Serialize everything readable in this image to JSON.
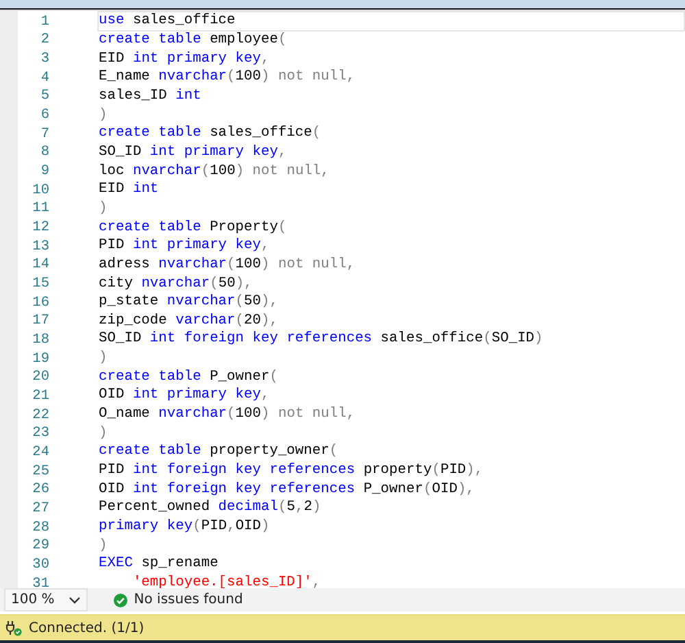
{
  "editor": {
    "lines": [
      {
        "number": "1",
        "current": true,
        "tokens": [
          {
            "kind": "keyword",
            "text": "use"
          },
          {
            "kind": "plain",
            "text": " sales_office"
          }
        ]
      },
      {
        "number": "2",
        "current": false,
        "tokens": [
          {
            "kind": "keyword",
            "text": "create table"
          },
          {
            "kind": "plain",
            "text": " employee"
          },
          {
            "kind": "punct",
            "text": "("
          }
        ]
      },
      {
        "number": "3",
        "current": false,
        "tokens": [
          {
            "kind": "plain",
            "text": "EID "
          },
          {
            "kind": "keyword",
            "text": "int primary key"
          },
          {
            "kind": "punct",
            "text": ","
          }
        ]
      },
      {
        "number": "4",
        "current": false,
        "tokens": [
          {
            "kind": "plain",
            "text": "E_name "
          },
          {
            "kind": "keyword",
            "text": "nvarchar"
          },
          {
            "kind": "punct",
            "text": "("
          },
          {
            "kind": "plain",
            "text": "100"
          },
          {
            "kind": "punct",
            "text": ") not null,"
          }
        ]
      },
      {
        "number": "5",
        "current": false,
        "tokens": [
          {
            "kind": "plain",
            "text": "sales_ID "
          },
          {
            "kind": "keyword",
            "text": "int"
          }
        ]
      },
      {
        "number": "6",
        "current": false,
        "tokens": [
          {
            "kind": "punct",
            "text": ")"
          }
        ]
      },
      {
        "number": "7",
        "current": false,
        "tokens": [
          {
            "kind": "keyword",
            "text": "create table"
          },
          {
            "kind": "plain",
            "text": " sales_office"
          },
          {
            "kind": "punct",
            "text": "("
          }
        ]
      },
      {
        "number": "8",
        "current": false,
        "tokens": [
          {
            "kind": "plain",
            "text": "SO_ID "
          },
          {
            "kind": "keyword",
            "text": "int primary key"
          },
          {
            "kind": "punct",
            "text": ","
          }
        ]
      },
      {
        "number": "9",
        "current": false,
        "tokens": [
          {
            "kind": "plain",
            "text": "loc "
          },
          {
            "kind": "keyword",
            "text": "nvarchar"
          },
          {
            "kind": "punct",
            "text": "("
          },
          {
            "kind": "plain",
            "text": "100"
          },
          {
            "kind": "punct",
            "text": ") not null,"
          }
        ]
      },
      {
        "number": "10",
        "current": false,
        "tokens": [
          {
            "kind": "plain",
            "text": "EID "
          },
          {
            "kind": "keyword",
            "text": "int"
          }
        ]
      },
      {
        "number": "11",
        "current": false,
        "tokens": [
          {
            "kind": "punct",
            "text": ")"
          }
        ]
      },
      {
        "number": "12",
        "current": false,
        "tokens": [
          {
            "kind": "keyword",
            "text": "create table"
          },
          {
            "kind": "plain",
            "text": " Property"
          },
          {
            "kind": "punct",
            "text": "("
          }
        ]
      },
      {
        "number": "13",
        "current": false,
        "tokens": [
          {
            "kind": "plain",
            "text": "PID "
          },
          {
            "kind": "keyword",
            "text": "int primary key"
          },
          {
            "kind": "punct",
            "text": ","
          }
        ]
      },
      {
        "number": "14",
        "current": false,
        "tokens": [
          {
            "kind": "plain",
            "text": "adress "
          },
          {
            "kind": "keyword",
            "text": "nvarchar"
          },
          {
            "kind": "punct",
            "text": "("
          },
          {
            "kind": "plain",
            "text": "100"
          },
          {
            "kind": "punct",
            "text": ") not null,"
          }
        ]
      },
      {
        "number": "15",
        "current": false,
        "tokens": [
          {
            "kind": "plain",
            "text": "city "
          },
          {
            "kind": "keyword",
            "text": "nvarchar"
          },
          {
            "kind": "punct",
            "text": "("
          },
          {
            "kind": "plain",
            "text": "50"
          },
          {
            "kind": "punct",
            "text": "),"
          }
        ]
      },
      {
        "number": "16",
        "current": false,
        "tokens": [
          {
            "kind": "plain",
            "text": "p_state "
          },
          {
            "kind": "keyword",
            "text": "nvarchar"
          },
          {
            "kind": "punct",
            "text": "("
          },
          {
            "kind": "plain",
            "text": "50"
          },
          {
            "kind": "punct",
            "text": "),"
          }
        ]
      },
      {
        "number": "17",
        "current": false,
        "tokens": [
          {
            "kind": "plain",
            "text": "zip_code "
          },
          {
            "kind": "keyword",
            "text": "varchar"
          },
          {
            "kind": "punct",
            "text": "("
          },
          {
            "kind": "plain",
            "text": "20"
          },
          {
            "kind": "punct",
            "text": "),"
          }
        ]
      },
      {
        "number": "18",
        "current": false,
        "tokens": [
          {
            "kind": "plain",
            "text": "SO_ID "
          },
          {
            "kind": "keyword",
            "text": "int foreign key references"
          },
          {
            "kind": "plain",
            "text": " sales_office"
          },
          {
            "kind": "punct",
            "text": "("
          },
          {
            "kind": "plain",
            "text": "SO_ID"
          },
          {
            "kind": "punct",
            "text": ")"
          }
        ]
      },
      {
        "number": "19",
        "current": false,
        "tokens": [
          {
            "kind": "punct",
            "text": ")"
          }
        ]
      },
      {
        "number": "20",
        "current": false,
        "tokens": [
          {
            "kind": "keyword",
            "text": "create table"
          },
          {
            "kind": "plain",
            "text": " P_owner"
          },
          {
            "kind": "punct",
            "text": "("
          }
        ]
      },
      {
        "number": "21",
        "current": false,
        "tokens": [
          {
            "kind": "plain",
            "text": "OID "
          },
          {
            "kind": "keyword",
            "text": "int primary key"
          },
          {
            "kind": "punct",
            "text": ","
          }
        ]
      },
      {
        "number": "22",
        "current": false,
        "tokens": [
          {
            "kind": "plain",
            "text": "O_name "
          },
          {
            "kind": "keyword",
            "text": "nvarchar"
          },
          {
            "kind": "punct",
            "text": "("
          },
          {
            "kind": "plain",
            "text": "100"
          },
          {
            "kind": "punct",
            "text": ") not null,"
          }
        ]
      },
      {
        "number": "23",
        "current": false,
        "tokens": [
          {
            "kind": "punct",
            "text": ")"
          }
        ]
      },
      {
        "number": "24",
        "current": false,
        "tokens": [
          {
            "kind": "keyword",
            "text": "create table"
          },
          {
            "kind": "plain",
            "text": " property_owner"
          },
          {
            "kind": "punct",
            "text": "("
          }
        ]
      },
      {
        "number": "25",
        "current": false,
        "tokens": [
          {
            "kind": "plain",
            "text": "PID "
          },
          {
            "kind": "keyword",
            "text": "int foreign key references"
          },
          {
            "kind": "plain",
            "text": " property"
          },
          {
            "kind": "punct",
            "text": "("
          },
          {
            "kind": "plain",
            "text": "PID"
          },
          {
            "kind": "punct",
            "text": "),"
          }
        ]
      },
      {
        "number": "26",
        "current": false,
        "tokens": [
          {
            "kind": "plain",
            "text": "OID "
          },
          {
            "kind": "keyword",
            "text": "int foreign key references"
          },
          {
            "kind": "plain",
            "text": " P_owner"
          },
          {
            "kind": "punct",
            "text": "("
          },
          {
            "kind": "plain",
            "text": "OID"
          },
          {
            "kind": "punct",
            "text": "),"
          }
        ]
      },
      {
        "number": "27",
        "current": false,
        "tokens": [
          {
            "kind": "plain",
            "text": "Percent_owned "
          },
          {
            "kind": "keyword",
            "text": "decimal"
          },
          {
            "kind": "punct",
            "text": "("
          },
          {
            "kind": "plain",
            "text": "5"
          },
          {
            "kind": "punct",
            "text": ","
          },
          {
            "kind": "plain",
            "text": "2"
          },
          {
            "kind": "punct",
            "text": ")"
          }
        ]
      },
      {
        "number": "28",
        "current": false,
        "tokens": [
          {
            "kind": "keyword",
            "text": "primary key"
          },
          {
            "kind": "punct",
            "text": "("
          },
          {
            "kind": "plain",
            "text": "PID"
          },
          {
            "kind": "punct",
            "text": ","
          },
          {
            "kind": "plain",
            "text": "OID"
          },
          {
            "kind": "punct",
            "text": ")"
          }
        ]
      },
      {
        "number": "29",
        "current": false,
        "tokens": [
          {
            "kind": "punct",
            "text": ")"
          }
        ]
      },
      {
        "number": "30",
        "current": false,
        "tokens": [
          {
            "kind": "keyword",
            "text": "EXEC"
          },
          {
            "kind": "plain",
            "text": " sp_rename"
          }
        ]
      },
      {
        "number": "31",
        "current": false,
        "tokens": [
          {
            "kind": "string",
            "text": "    'employee.[sales_ID]'"
          },
          {
            "kind": "punct",
            "text": ","
          }
        ]
      }
    ]
  },
  "footer": {
    "zoom": "100 %",
    "issues": "No issues found"
  },
  "status_bar": {
    "text": "Connected. (1/1)"
  }
}
